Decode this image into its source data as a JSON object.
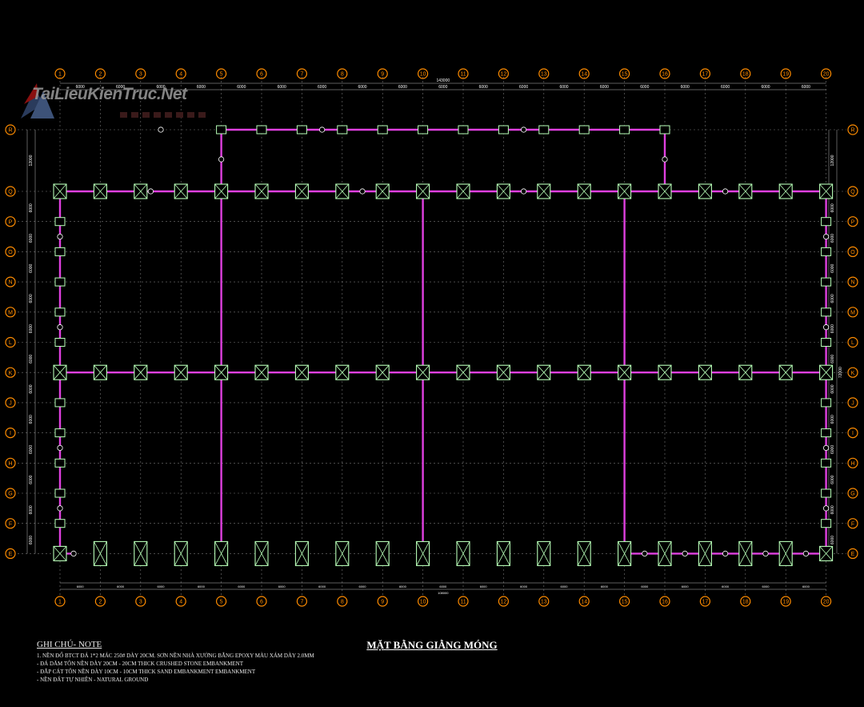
{
  "grid": {
    "cols": [
      "1",
      "2",
      "3",
      "4",
      "5",
      "6",
      "7",
      "8",
      "9",
      "10",
      "11",
      "12",
      "13",
      "14",
      "15",
      "16",
      "17",
      "18",
      "19",
      "20"
    ],
    "rows": [
      "R",
      "Q",
      "P",
      "O",
      "N",
      "M",
      "L",
      "K",
      "J",
      "I",
      "H",
      "G",
      "F",
      "E"
    ],
    "col_spacing_label": "6000",
    "row_spacing_label": "6000",
    "top_total": "143000",
    "bottom_total": "108000",
    "side_top_span": "12000",
    "side_mid_span": "72000"
  },
  "colors": {
    "beam": "#e040e0",
    "column": "#b8ffb8",
    "grid": "#777777",
    "bubble": "#ff8c00",
    "text": "#ffffff"
  },
  "watermark": {
    "text": "TaiLieuKienTruc.Net"
  },
  "title": "MẶT BẰNG GIẰNG MÓNG",
  "notes": {
    "heading": "GHI CHÚ- NOTE",
    "lines": [
      "1. NỀN ĐỔ BTCT ĐÁ 1*2 MÁC 250# DÀY 20CM. SƠN NỀN NHÀ XƯỞNG BẰNG EPOXY MÀU XÁM DÀY 2.0MM",
      "- ĐÁ DĂM TÔN NỀN DÀY 20CM - 20CM THICK CRUSHED STONE EMBANKMENT",
      "- ĐẮP CÁT TÔN NỀN DÀY 10CM - 10CM THICK SAND EMBANKMENT EMBANKMENT",
      "- NỀN ĐẤT TỰ NHIÊN - NATURAL GROUND"
    ]
  }
}
